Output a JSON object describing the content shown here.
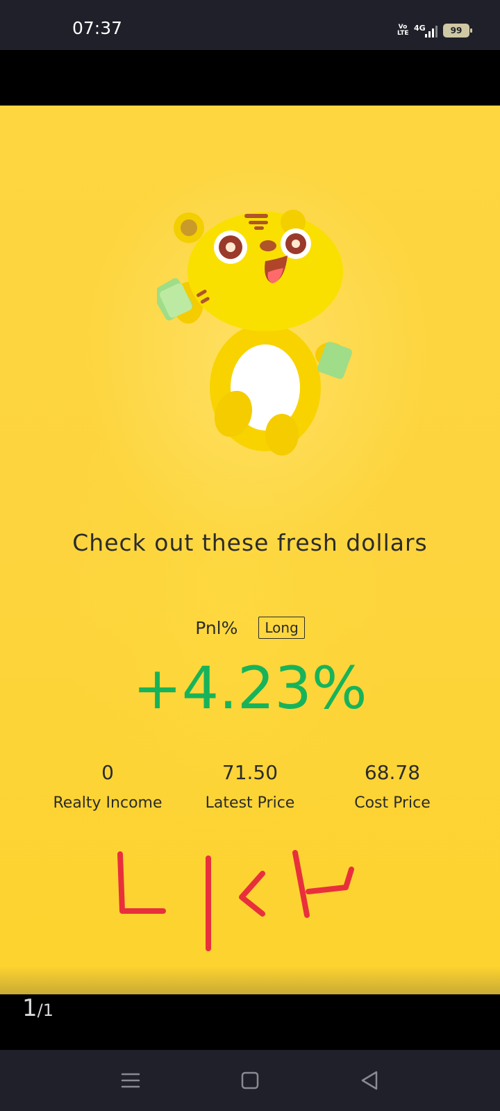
{
  "status_bar": {
    "time": "07:37",
    "volte_label": "Vo LTE",
    "network_label": "4G",
    "battery": "99"
  },
  "card": {
    "headline": "Check out these fresh dollars",
    "pnl_label": "Pnl%",
    "position_badge": "Long",
    "pnl_value": "+4.23%",
    "stats": [
      {
        "value": "0",
        "label": "Realty Income"
      },
      {
        "value": "71.50",
        "label": "Latest Price"
      },
      {
        "value": "68.78",
        "label": "Cost Price"
      }
    ],
    "handwriting": "LICK"
  },
  "pager": {
    "current": "1",
    "total": "/1"
  },
  "nav_bar": {
    "menu_icon": "menu-icon",
    "home_icon": "home-icon",
    "back_icon": "back-icon"
  },
  "colors": {
    "card_bg": "#fdd43d",
    "positive": "#17b35a",
    "scribble": "#e8303c",
    "bars_bg": "#1f2029"
  }
}
